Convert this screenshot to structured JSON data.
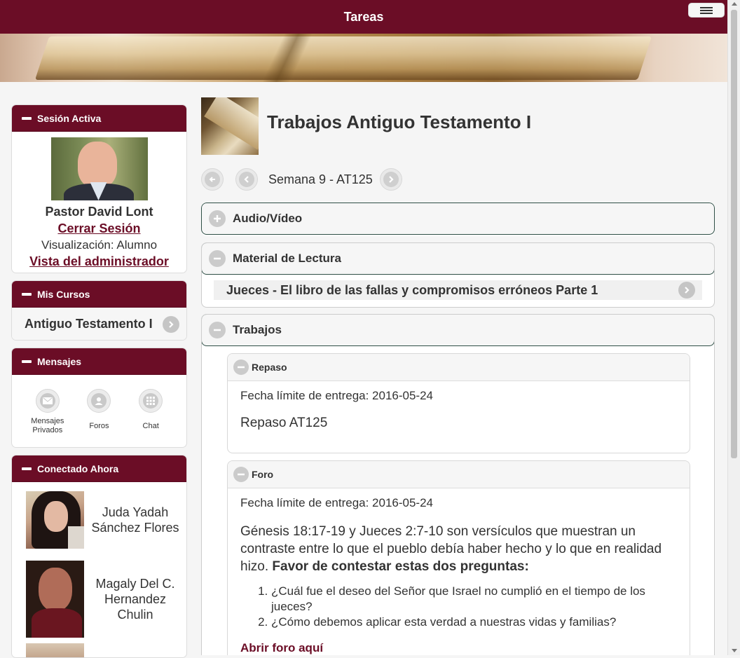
{
  "header": {
    "title": "Tareas"
  },
  "sidebar": {
    "session": {
      "title": "Sesión Activa",
      "user_name": "Pastor David Lont",
      "logout": "Cerrar Sesión",
      "view": "Visualización: Alumno",
      "admin_link": "Vista del administrador"
    },
    "courses": {
      "title": "Mis Cursos",
      "items": [
        {
          "label": "Antiguo Testamento I"
        }
      ]
    },
    "messages": {
      "title": "Mensajes",
      "items": [
        {
          "label": "Mensajes Privados",
          "icon": "mail-icon"
        },
        {
          "label": "Foros",
          "icon": "user-icon"
        },
        {
          "label": "Chat",
          "icon": "grid-icon"
        }
      ]
    },
    "online": {
      "title": "Conectado Ahora",
      "users": [
        {
          "name": "Juda Yadah Sánchez Flores"
        },
        {
          "name": "Magaly Del C. Hernandez Chulin"
        }
      ]
    }
  },
  "main": {
    "title": "Trabajos Antiguo Testamento I",
    "week_label": "Semana 9 - AT125",
    "sections": {
      "audio": {
        "title": "Audio/Vídeo"
      },
      "reading": {
        "title": "Material de Lectura",
        "items": [
          {
            "label": "Jueces - El libro de las fallas y compromisos erróneos Parte 1"
          }
        ]
      },
      "assignments": {
        "title": "Trabajos"
      }
    },
    "tasks": [
      {
        "title": "Repaso",
        "due": "Fecha límite de entrega: 2016-05-24",
        "name": "Repaso AT125"
      },
      {
        "title": "Foro",
        "due": "Fecha límite de entrega: 2016-05-24",
        "text": "Génesis 18:17-19 y Jueces 2:7-10 son versículos que muestran un contraste entre lo que el pueblo debía haber hecho y lo que en realidad hizo.",
        "bold": "Favor de contestar estas dos preguntas:",
        "questions": [
          "¿Cuál fue el deseo del Señor que Israel no cumplió en el tiempo de los jueces?",
          "¿Cómo debemos aplicar esta verdad a nuestras vidas y familias?"
        ],
        "link": "Abrir foro aquí"
      }
    ]
  },
  "colors": {
    "brand": "#6b0d26",
    "panel_border": "#ddd"
  }
}
